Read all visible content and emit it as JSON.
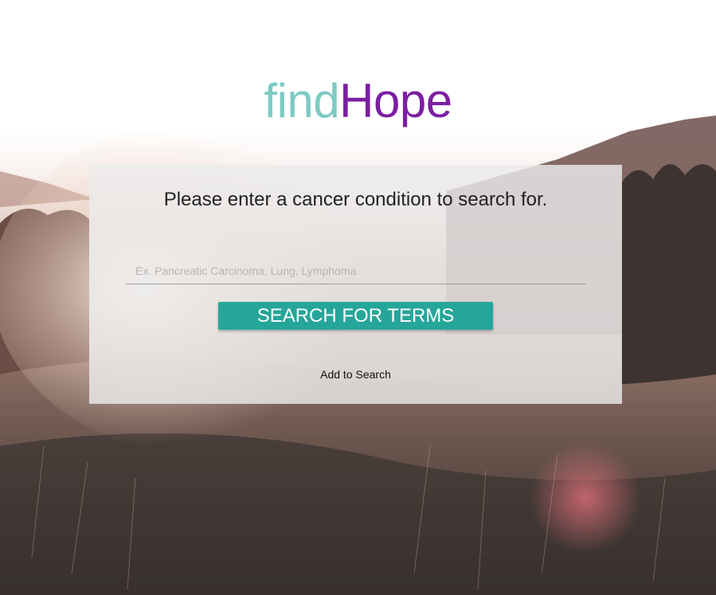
{
  "logo": {
    "part1": "find",
    "part2": "Hope"
  },
  "colors": {
    "logo_find": "#7ecac4",
    "logo_hope": "#7b1fa2",
    "button": "#26a69a"
  },
  "search_card": {
    "title": "Please enter a cancer condition to search for.",
    "input": {
      "value": "",
      "placeholder": "Ex. Pancreatic Carcinoma, Lung, Lymphoma"
    },
    "search_button_label": "SEARCH FOR TERMS",
    "add_link_label": "Add to Search"
  },
  "background": {
    "description_icon": "landscape-photo"
  }
}
